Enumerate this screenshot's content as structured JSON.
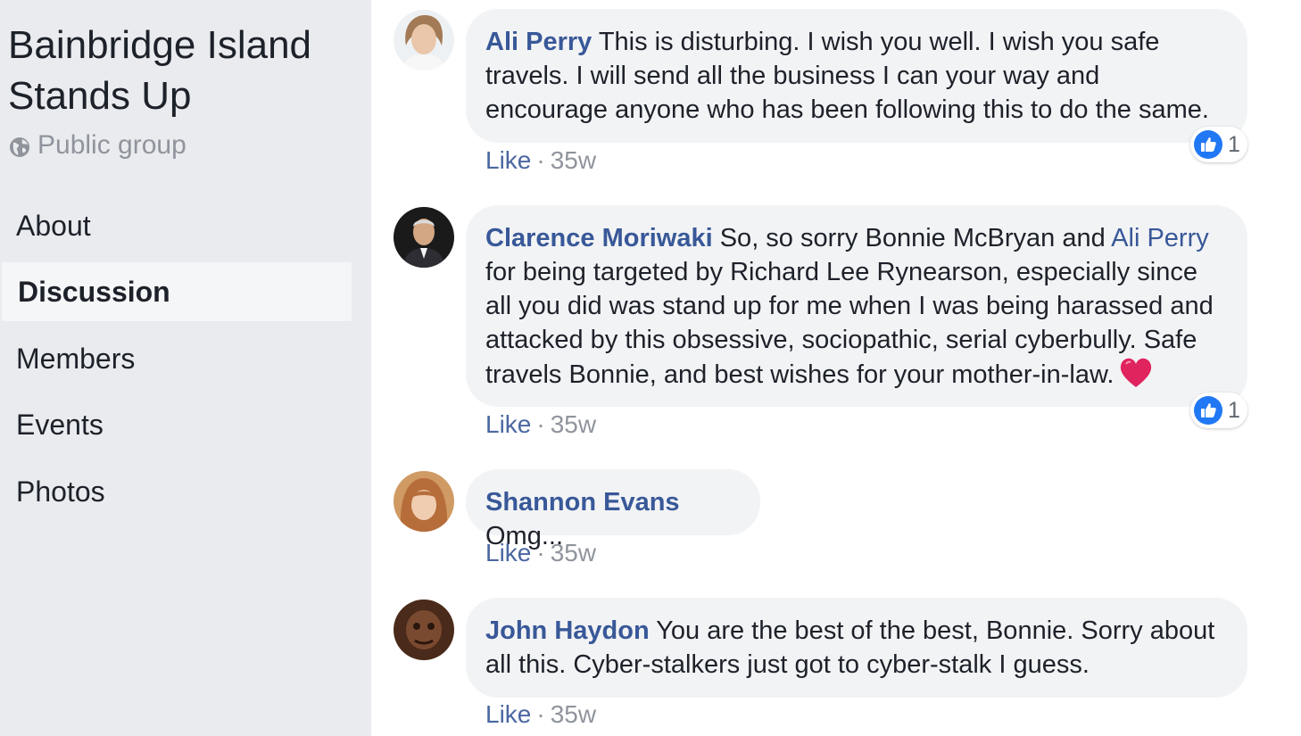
{
  "group": {
    "title": "Bainbridge Island Stands Up",
    "privacy": "Public group",
    "privacy_icon": "globe-icon"
  },
  "nav": {
    "items": [
      {
        "label": "About"
      },
      {
        "label": "Discussion",
        "active": true
      },
      {
        "label": "Members"
      },
      {
        "label": "Events"
      },
      {
        "label": "Photos"
      }
    ]
  },
  "comments": [
    {
      "author": "Ali Perry",
      "text": "This is disturbing. I wish you well. I wish you safe travels. I will send all the business I can your way and encourage anyone who has been following this to do the same.",
      "like_label": "Like",
      "separator": "·",
      "time": "35w",
      "reaction_count": "1",
      "reaction_icon": "thumbs-up-icon"
    },
    {
      "author": "Clarence Moriwaki",
      "text_parts": [
        "So, so sorry Bonnie McBryan and",
        "Ali Perry",
        "for being targeted by Richard Lee Rynearson, especially since all you did was stand up for me when I was being harassed and attacked by this obsessive, sociopathic, serial cyberbully. Safe travels Bonnie, and best wishes for your mother-in-law."
      ],
      "emoji": "heart-icon",
      "like_label": "Like",
      "separator": "·",
      "time": "35w",
      "reaction_count": "1",
      "reaction_icon": "thumbs-up-icon"
    },
    {
      "author": "Shannon Evans",
      "text": "Omg...",
      "like_label": "Like",
      "separator": "·",
      "time": "35w"
    },
    {
      "author": "John Haydon",
      "text": "You are the best of the best, Bonnie. Sorry about all this. Cyber-stalkers just got to cyber-stalk I guess.",
      "like_label": "Like",
      "separator": "·",
      "time": "35w"
    }
  ],
  "colors": {
    "sidebar_bg": "#e9ebee",
    "bubble_bg": "#f2f3f5",
    "link": "#385898",
    "meta": "#90949c",
    "like_blue": "#2078f4",
    "heart_red": "#e0245e"
  }
}
